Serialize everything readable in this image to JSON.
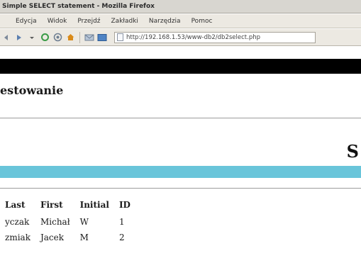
{
  "window": {
    "title": "Simple SELECT statement - Mozilla Firefox"
  },
  "menu": [
    "Edycja",
    "Widok",
    "Przejdź",
    "Zakładki",
    "Narzędzia",
    "Pomoc"
  ],
  "toolbar": {
    "url": "http://192.168.1.53/www-db2/db2select.php"
  },
  "page": {
    "heading": "estowanie",
    "right_heading": "S",
    "table": {
      "headers": [
        "Last",
        "First",
        "Initial",
        "ID"
      ],
      "rows": [
        [
          "yczak",
          "Michał",
          "W",
          "1"
        ],
        [
          "zmiak",
          "Jacek",
          "M",
          "2"
        ]
      ]
    }
  },
  "colors": {
    "banner_black": "#000000",
    "banner_cyan": "#69c5da"
  },
  "icons": [
    "back-icon",
    "forward-icon",
    "reload-icon",
    "stop-icon",
    "home-icon",
    "mail-icon",
    "bookmark-icon",
    "page-icon"
  ]
}
